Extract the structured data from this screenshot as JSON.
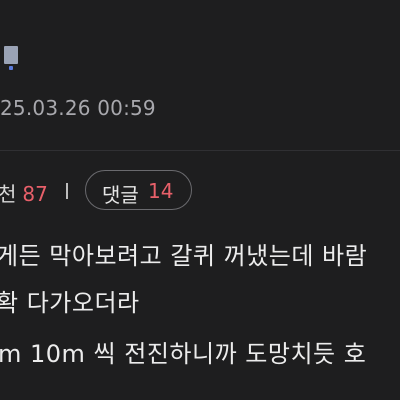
{
  "post": {
    "timestamp": "25.03.26 00:59",
    "recommend_label": "천",
    "recommend_count": "87",
    "comments_label": "댓글",
    "comments_count": "14",
    "lines": [
      "게든 막아보려고 갈퀴 꺼냈는데 바람",
      "확 다가오더라",
      "m 10m 씩 전진하니까 도망치듯 호"
    ]
  },
  "icons": {
    "attachment": "file-icon"
  },
  "colors": {
    "background": "#1e1e1f",
    "count_accent": "#e8606a",
    "meta_text": "#a8a8ad",
    "body_text": "#ececec"
  }
}
